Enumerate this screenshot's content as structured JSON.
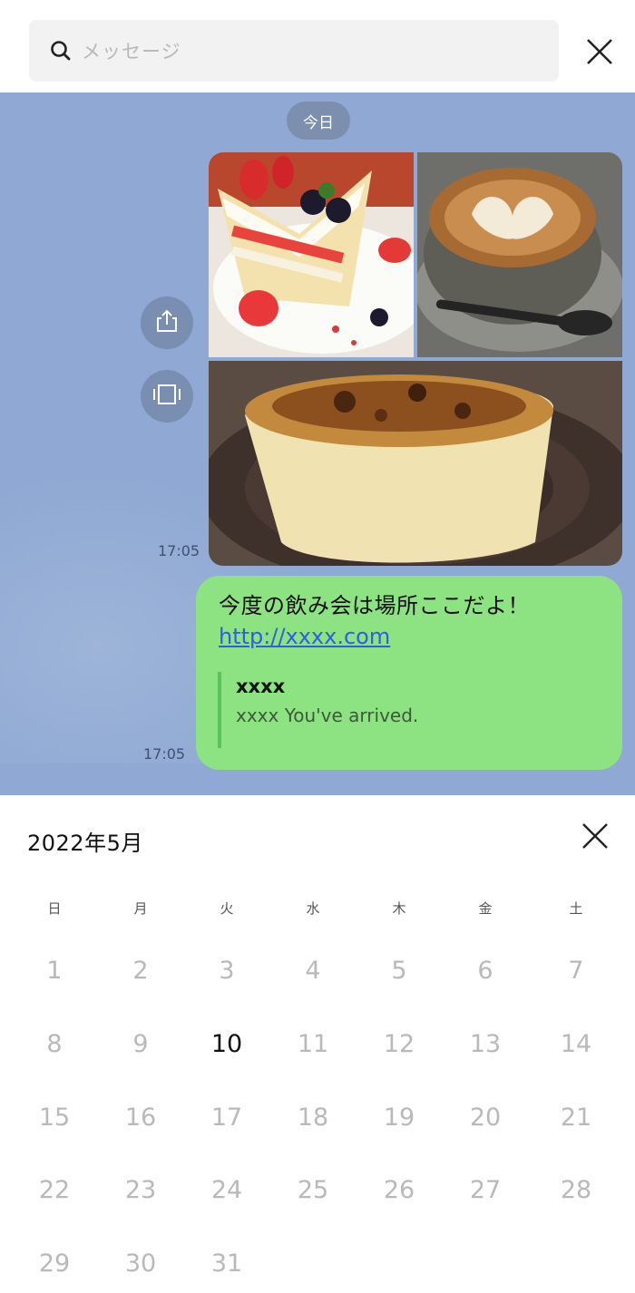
{
  "search": {
    "placeholder": "メッセージ"
  },
  "chat": {
    "date_chip": "今日",
    "image_message": {
      "time": "17:05"
    },
    "text_message": {
      "text": "今度の飲み会は場所ここだよ！",
      "link": "http://xxxx.com",
      "preview_title": "xxxx",
      "preview_description": "xxxx You've arrived.",
      "time": "17:05"
    },
    "colors": {
      "background": "#8fa9d4",
      "bubble": "#8de281",
      "link": "#2f5ee0"
    }
  },
  "calendar": {
    "title": "2022年5月",
    "weekdays": [
      "日",
      "月",
      "火",
      "水",
      "木",
      "金",
      "土"
    ],
    "days": [
      "1",
      "2",
      "3",
      "4",
      "5",
      "6",
      "7",
      "8",
      "9",
      "10",
      "11",
      "12",
      "13",
      "14",
      "15",
      "16",
      "17",
      "18",
      "19",
      "20",
      "21",
      "22",
      "23",
      "24",
      "25",
      "26",
      "27",
      "28",
      "29",
      "30",
      "31"
    ],
    "current_day": "10"
  },
  "icons": [
    "search-icon",
    "close-icon",
    "share-icon",
    "slideshow-icon"
  ]
}
